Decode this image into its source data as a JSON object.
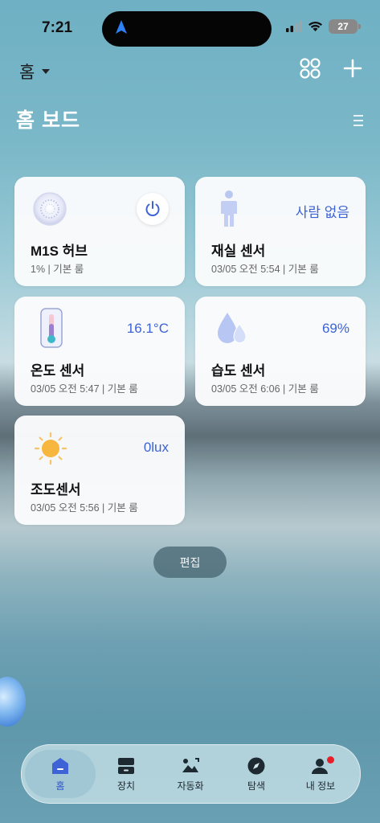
{
  "status_bar": {
    "time": "7:21",
    "battery": "27"
  },
  "header": {
    "home_label": "홈"
  },
  "page": {
    "title": "홈 보드"
  },
  "cards": [
    {
      "title": "M1S 허브",
      "subtitle": "1% | 기본 룸",
      "value": ""
    },
    {
      "title": "재실 센서",
      "subtitle": "03/05 오전 5:54 | 기본 룸",
      "value": "사람 없음"
    },
    {
      "title": "온도 센서",
      "subtitle": "03/05 오전 5:47 | 기본 룸",
      "value": "16.1°C"
    },
    {
      "title": "습도 센서",
      "subtitle": "03/05 오전 6:06 | 기본 룸",
      "value": "69%"
    },
    {
      "title": "조도센서",
      "subtitle": "03/05 오전 5:56 | 기본 룸",
      "value": "0lux"
    }
  ],
  "edit_label": "편집",
  "tabs": [
    {
      "label": "홈",
      "icon": "home-icon"
    },
    {
      "label": "장치",
      "icon": "devices-icon"
    },
    {
      "label": "자동화",
      "icon": "automation-icon"
    },
    {
      "label": "탐색",
      "icon": "compass-icon"
    },
    {
      "label": "내 정보",
      "icon": "profile-icon"
    }
  ],
  "colors": {
    "accent": "#3d63d6",
    "notification": "#e81f2b"
  }
}
